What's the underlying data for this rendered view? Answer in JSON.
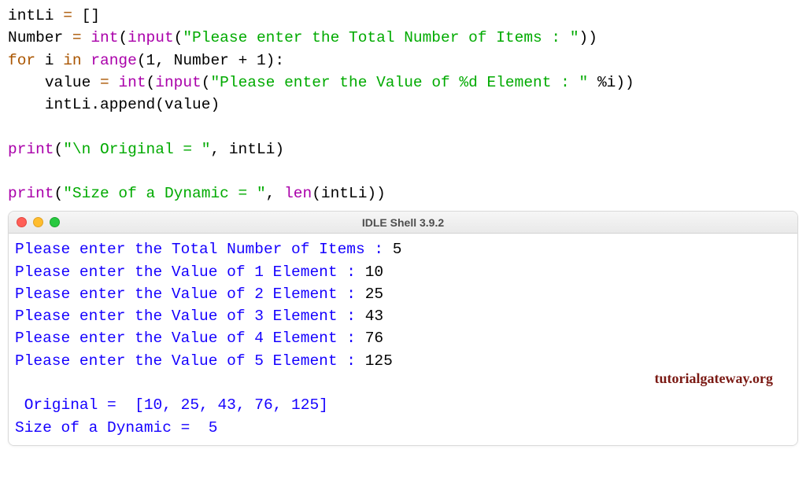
{
  "code": {
    "l1": {
      "a": "intLi ",
      "eq": "=",
      "b": " []"
    },
    "l2": {
      "a": "Number ",
      "eq": "=",
      "b": " ",
      "int": "int",
      "p1": "(",
      "input": "input",
      "p2": "(",
      "str": "\"Please enter the Total Number of Items : \"",
      "p3": "))"
    },
    "l3": {
      "for": "for",
      "sp1": " i ",
      "in": "in",
      "sp2": " ",
      "range": "range",
      "args": "(1, Number + 1):"
    },
    "l4": {
      "ind": "    ",
      "a": "value ",
      "eq": "=",
      "b": " ",
      "int": "int",
      "p1": "(",
      "input": "input",
      "p2": "(",
      "str": "\"Please enter the Value of %d Element : \"",
      "tail": " %i))"
    },
    "l5": {
      "ind": "    ",
      "call": "intLi.append(value)"
    },
    "l7": {
      "print": "print",
      "p1": "(",
      "str": "\"\\n Original = \"",
      "tail": ", intLi)"
    },
    "l9": {
      "print": "print",
      "p1": "(",
      "str": "\"Size of a Dynamic = \"",
      "mid": ", ",
      "len": "len",
      "tail": "(intLi))"
    }
  },
  "window_title": "IDLE Shell 3.9.2",
  "shell": {
    "prompts": [
      {
        "t": "Please enter the Total Number of Items : ",
        "v": "5"
      },
      {
        "t": "Please enter the Value of 1 Element : ",
        "v": "10"
      },
      {
        "t": "Please enter the Value of 2 Element : ",
        "v": "25"
      },
      {
        "t": "Please enter the Value of 3 Element : ",
        "v": "43"
      },
      {
        "t": "Please enter the Value of 4 Element : ",
        "v": "76"
      },
      {
        "t": "Please enter the Value of 5 Element : ",
        "v": "125"
      }
    ],
    "blank": "",
    "out1": " Original =  [10, 25, 43, 76, 125]",
    "out2": "Size of a Dynamic =  5"
  },
  "watermark": "tutorialgateway.org"
}
